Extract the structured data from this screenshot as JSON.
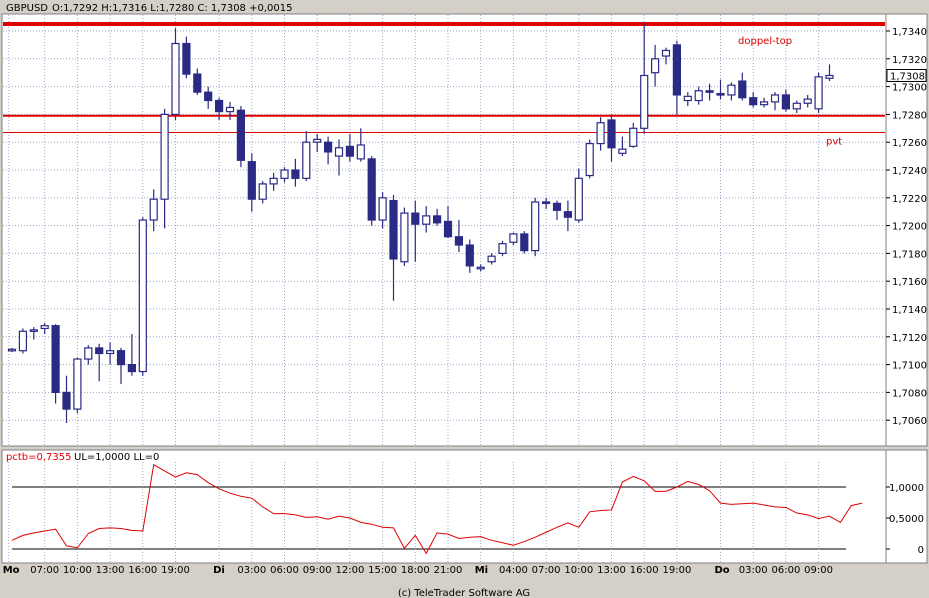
{
  "header": {
    "symbol": "GBPUSD",
    "ohlc": "O:1,7292 H:1,7316 L:1,7280 C: 1,7308 +0,0015"
  },
  "indicator_header": {
    "value_label": "pctb=0,7355",
    "limits_label": "UL=1,0000 LL=0"
  },
  "current_price_label": "1,7308",
  "footer": "(c) TeleTrader Software AG",
  "colors": {
    "background": "#ffffff",
    "frame": "#d4d0c8",
    "grid": "#9aa8c8",
    "up_candle_fill": "#ffffff",
    "down_candle_fill": "#2b2b86",
    "candle_outline": "#2b2b86",
    "resistance": "#e00000",
    "indicator_line": "#e00000",
    "annotation": "#e00000"
  },
  "chart_data": [
    {
      "type": "candlestick",
      "title": "GBPUSD",
      "ylim": [
        1.704,
        1.735
      ],
      "y_ticks": [
        {
          "v": 1.706,
          "label": "1,7060"
        },
        {
          "v": 1.708,
          "label": "1,7080"
        },
        {
          "v": 1.71,
          "label": "1,7100"
        },
        {
          "v": 1.712,
          "label": "1,7120"
        },
        {
          "v": 1.714,
          "label": "1,7140"
        },
        {
          "v": 1.716,
          "label": "1,7160"
        },
        {
          "v": 1.718,
          "label": "1,7180"
        },
        {
          "v": 1.72,
          "label": "1,7200"
        },
        {
          "v": 1.722,
          "label": "1,7220"
        },
        {
          "v": 1.724,
          "label": "1,7240"
        },
        {
          "v": 1.726,
          "label": "1,7260"
        },
        {
          "v": 1.728,
          "label": "1,7280"
        },
        {
          "v": 1.73,
          "label": "1,7300"
        },
        {
          "v": 1.732,
          "label": "1,7320"
        },
        {
          "v": 1.734,
          "label": "1,7340"
        }
      ],
      "x_ticks": [
        {
          "i": -0.3,
          "label": "Mo",
          "bold": true
        },
        {
          "i": 3,
          "label": "07:00"
        },
        {
          "i": 6,
          "label": "10:00"
        },
        {
          "i": 9,
          "label": "13:00"
        },
        {
          "i": 12,
          "label": "16:00"
        },
        {
          "i": 15,
          "label": "19:00"
        },
        {
          "i": 19,
          "label": "Di",
          "bold": true
        },
        {
          "i": 22,
          "label": "03:00"
        },
        {
          "i": 25,
          "label": "06:00"
        },
        {
          "i": 28,
          "label": "09:00"
        },
        {
          "i": 31,
          "label": "12:00"
        },
        {
          "i": 34,
          "label": "15:00"
        },
        {
          "i": 37,
          "label": "18:00"
        },
        {
          "i": 40,
          "label": "21:00"
        },
        {
          "i": 43,
          "label": "Mi",
          "bold": true
        },
        {
          "i": 46,
          "label": "04:00"
        },
        {
          "i": 49,
          "label": "07:00"
        },
        {
          "i": 52,
          "label": "10:00"
        },
        {
          "i": 55,
          "label": "13:00"
        },
        {
          "i": 58,
          "label": "16:00"
        },
        {
          "i": 61,
          "label": "19:00"
        },
        {
          "i": 65,
          "label": "Do",
          "bold": true
        },
        {
          "i": 68,
          "label": "03:00"
        },
        {
          "i": 71,
          "label": "06:00"
        },
        {
          "i": 74,
          "label": "09:00"
        }
      ],
      "candles": [
        {
          "o": 1.711,
          "h": 1.7112,
          "l": 1.7109,
          "c": 1.7111
        },
        {
          "o": 1.711,
          "h": 1.7126,
          "l": 1.7108,
          "c": 1.7124
        },
        {
          "o": 1.7124,
          "h": 1.7127,
          "l": 1.7118,
          "c": 1.7125
        },
        {
          "o": 1.7126,
          "h": 1.713,
          "l": 1.7122,
          "c": 1.7128
        },
        {
          "o": 1.7128,
          "h": 1.7129,
          "l": 1.7072,
          "c": 1.708
        },
        {
          "o": 1.708,
          "h": 1.7092,
          "l": 1.7058,
          "c": 1.7068
        },
        {
          "o": 1.7068,
          "h": 1.7105,
          "l": 1.7065,
          "c": 1.7104
        },
        {
          "o": 1.7104,
          "h": 1.7114,
          "l": 1.71,
          "c": 1.7112
        },
        {
          "o": 1.7112,
          "h": 1.7115,
          "l": 1.7088,
          "c": 1.7108
        },
        {
          "o": 1.7108,
          "h": 1.7116,
          "l": 1.71,
          "c": 1.711
        },
        {
          "o": 1.711,
          "h": 1.7112,
          "l": 1.7086,
          "c": 1.71
        },
        {
          "o": 1.71,
          "h": 1.7122,
          "l": 1.7092,
          "c": 1.7095
        },
        {
          "o": 1.7095,
          "h": 1.7206,
          "l": 1.7092,
          "c": 1.7204
        },
        {
          "o": 1.7204,
          "h": 1.7226,
          "l": 1.7196,
          "c": 1.7219
        },
        {
          "o": 1.7219,
          "h": 1.7284,
          "l": 1.7198,
          "c": 1.728
        },
        {
          "o": 1.728,
          "h": 1.7342,
          "l": 1.7276,
          "c": 1.7331
        },
        {
          "o": 1.7331,
          "h": 1.7336,
          "l": 1.7306,
          "c": 1.7309
        },
        {
          "o": 1.7309,
          "h": 1.7313,
          "l": 1.7294,
          "c": 1.7296
        },
        {
          "o": 1.7296,
          "h": 1.73,
          "l": 1.7284,
          "c": 1.729
        },
        {
          "o": 1.729,
          "h": 1.7292,
          "l": 1.7276,
          "c": 1.7282
        },
        {
          "o": 1.7282,
          "h": 1.7289,
          "l": 1.7276,
          "c": 1.7285
        },
        {
          "o": 1.7283,
          "h": 1.7286,
          "l": 1.7242,
          "c": 1.7247
        },
        {
          "o": 1.7246,
          "h": 1.7252,
          "l": 1.721,
          "c": 1.7219
        },
        {
          "o": 1.7219,
          "h": 1.7232,
          "l": 1.7216,
          "c": 1.723
        },
        {
          "o": 1.723,
          "h": 1.7238,
          "l": 1.7225,
          "c": 1.7234
        },
        {
          "o": 1.7234,
          "h": 1.7242,
          "l": 1.7231,
          "c": 1.724
        },
        {
          "o": 1.724,
          "h": 1.7248,
          "l": 1.7228,
          "c": 1.7234
        },
        {
          "o": 1.7234,
          "h": 1.7268,
          "l": 1.7232,
          "c": 1.726
        },
        {
          "o": 1.726,
          "h": 1.7266,
          "l": 1.7253,
          "c": 1.7262
        },
        {
          "o": 1.726,
          "h": 1.7264,
          "l": 1.7244,
          "c": 1.7253
        },
        {
          "o": 1.725,
          "h": 1.7262,
          "l": 1.7236,
          "c": 1.7256
        },
        {
          "o": 1.7257,
          "h": 1.7266,
          "l": 1.7246,
          "c": 1.725
        },
        {
          "o": 1.7248,
          "h": 1.727,
          "l": 1.7246,
          "c": 1.7258
        },
        {
          "o": 1.7248,
          "h": 1.725,
          "l": 1.72,
          "c": 1.7204
        },
        {
          "o": 1.7204,
          "h": 1.7224,
          "l": 1.7198,
          "c": 1.722
        },
        {
          "o": 1.7218,
          "h": 1.7222,
          "l": 1.7146,
          "c": 1.7176
        },
        {
          "o": 1.7174,
          "h": 1.7213,
          "l": 1.7171,
          "c": 1.7209
        },
        {
          "o": 1.7209,
          "h": 1.7218,
          "l": 1.7174,
          "c": 1.7201
        },
        {
          "o": 1.7201,
          "h": 1.7214,
          "l": 1.7195,
          "c": 1.7207
        },
        {
          "o": 1.7207,
          "h": 1.7212,
          "l": 1.72,
          "c": 1.7202
        },
        {
          "o": 1.7203,
          "h": 1.7214,
          "l": 1.7191,
          "c": 1.7192
        },
        {
          "o": 1.7192,
          "h": 1.7204,
          "l": 1.7181,
          "c": 1.7186
        },
        {
          "o": 1.7186,
          "h": 1.719,
          "l": 1.7166,
          "c": 1.7171
        },
        {
          "o": 1.717,
          "h": 1.7172,
          "l": 1.7167,
          "c": 1.717
        },
        {
          "o": 1.7174,
          "h": 1.718,
          "l": 1.7172,
          "c": 1.7178
        },
        {
          "o": 1.718,
          "h": 1.7189,
          "l": 1.7178,
          "c": 1.7187
        },
        {
          "o": 1.7188,
          "h": 1.7195,
          "l": 1.7186,
          "c": 1.7194
        },
        {
          "o": 1.7194,
          "h": 1.7196,
          "l": 1.718,
          "c": 1.7182
        },
        {
          "o": 1.7182,
          "h": 1.722,
          "l": 1.7178,
          "c": 1.7217
        },
        {
          "o": 1.7217,
          "h": 1.722,
          "l": 1.7212,
          "c": 1.7216
        },
        {
          "o": 1.7216,
          "h": 1.7218,
          "l": 1.7204,
          "c": 1.7211
        },
        {
          "o": 1.721,
          "h": 1.7218,
          "l": 1.7196,
          "c": 1.7206
        },
        {
          "o": 1.7204,
          "h": 1.7241,
          "l": 1.7202,
          "c": 1.7234
        },
        {
          "o": 1.7236,
          "h": 1.7262,
          "l": 1.7234,
          "c": 1.7259
        },
        {
          "o": 1.7259,
          "h": 1.7278,
          "l": 1.7254,
          "c": 1.7274
        },
        {
          "o": 1.7276,
          "h": 1.728,
          "l": 1.7246,
          "c": 1.7256
        },
        {
          "o": 1.7252,
          "h": 1.7264,
          "l": 1.725,
          "c": 1.7255
        },
        {
          "o": 1.7257,
          "h": 1.7274,
          "l": 1.7256,
          "c": 1.727
        },
        {
          "o": 1.727,
          "h": 1.7346,
          "l": 1.7266,
          "c": 1.7308
        },
        {
          "o": 1.731,
          "h": 1.733,
          "l": 1.73,
          "c": 1.732
        },
        {
          "o": 1.7322,
          "h": 1.7328,
          "l": 1.7316,
          "c": 1.7326
        },
        {
          "o": 1.733,
          "h": 1.7333,
          "l": 1.728,
          "c": 1.7294
        },
        {
          "o": 1.729,
          "h": 1.7296,
          "l": 1.7286,
          "c": 1.7293
        },
        {
          "o": 1.729,
          "h": 1.73,
          "l": 1.7287,
          "c": 1.7297
        },
        {
          "o": 1.7297,
          "h": 1.7302,
          "l": 1.729,
          "c": 1.7296
        },
        {
          "o": 1.7295,
          "h": 1.7305,
          "l": 1.7291,
          "c": 1.7294
        },
        {
          "o": 1.7294,
          "h": 1.7303,
          "l": 1.729,
          "c": 1.7301
        },
        {
          "o": 1.7304,
          "h": 1.731,
          "l": 1.729,
          "c": 1.7292
        },
        {
          "o": 1.7292,
          "h": 1.7296,
          "l": 1.7285,
          "c": 1.7287
        },
        {
          "o": 1.7287,
          "h": 1.7292,
          "l": 1.7285,
          "c": 1.7289
        },
        {
          "o": 1.7289,
          "h": 1.7296,
          "l": 1.7283,
          "c": 1.7294
        },
        {
          "o": 1.7294,
          "h": 1.7298,
          "l": 1.7282,
          "c": 1.7284
        },
        {
          "o": 1.7284,
          "h": 1.729,
          "l": 1.7281,
          "c": 1.7288
        },
        {
          "o": 1.7288,
          "h": 1.7294,
          "l": 1.7285,
          "c": 1.7291
        },
        {
          "o": 1.7284,
          "h": 1.731,
          "l": 1.7281,
          "c": 1.7307
        },
        {
          "o": 1.7306,
          "h": 1.7316,
          "l": 1.7304,
          "c": 1.7308
        }
      ],
      "horizontal_lines": [
        {
          "value": 1.7345,
          "label": "doppel-top",
          "weight": "thick"
        },
        {
          "value": 1.7279,
          "label": "",
          "weight": "medium"
        },
        {
          "value": 1.7267,
          "label": "pvt",
          "weight": "thin"
        }
      ]
    },
    {
      "type": "line",
      "name": "pctb",
      "ylim": [
        -0.05,
        1.25
      ],
      "y_ticks": [
        {
          "v": 0,
          "label": "0"
        },
        {
          "v": 0.5,
          "label": "0,5000"
        },
        {
          "v": 1.0,
          "label": "1,0000"
        }
      ],
      "reference_lines": [
        0,
        1.0
      ],
      "values": [
        0.14,
        0.22,
        0.26,
        0.29,
        0.32,
        0.05,
        0.02,
        0.25,
        0.33,
        0.34,
        0.33,
        0.3,
        0.29,
        1.36,
        1.26,
        1.16,
        1.23,
        1.2,
        1.07,
        0.97,
        0.9,
        0.85,
        0.82,
        0.68,
        0.57,
        0.57,
        0.55,
        0.51,
        0.52,
        0.48,
        0.53,
        0.5,
        0.43,
        0.4,
        0.35,
        0.34,
        0.01,
        0.22,
        -0.07,
        0.26,
        0.24,
        0.17,
        0.19,
        0.2,
        0.14,
        0.1,
        0.06,
        0.12,
        0.19,
        0.27,
        0.35,
        0.42,
        0.35,
        0.6,
        0.62,
        0.63,
        1.08,
        1.17,
        1.1,
        0.93,
        0.93,
        1.0,
        1.09,
        1.04,
        0.94,
        0.74,
        0.72,
        0.73,
        0.74,
        0.71,
        0.68,
        0.67,
        0.58,
        0.55,
        0.49,
        0.53,
        0.43,
        0.7,
        0.74
      ]
    }
  ]
}
